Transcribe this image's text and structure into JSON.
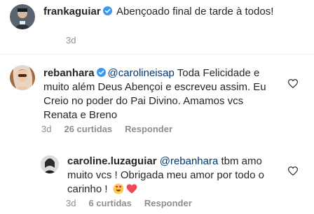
{
  "caption": {
    "username": "frankaguiar",
    "text": " Abençoado final de tarde à todos!",
    "time": "3d"
  },
  "comment": {
    "username": "rebanhara",
    "mention": "@carolineisap",
    "text": " Toda Felicidade e muito além Deus Abençoi e escreveu assim. Eu Creio no poder do Pai Divino. Amamos vcs Renata e Breno",
    "time": "3d",
    "likes": "26 curtidas",
    "reply_label": "Responder"
  },
  "reply": {
    "username": "caroline.luzaguiar",
    "mention": "@rebanhara",
    "text": " tbm amo muito vcs ! Obrigada meu amor por todo o carinho ! ",
    "time": "3d",
    "likes": "6 curtidas",
    "reply_label": "Responder"
  },
  "colors": {
    "verified": "#3897f0",
    "mention": "#00376b",
    "meta": "#8e8e8e",
    "heart_outline": "#262626",
    "heart_emoji": "#ed4956"
  },
  "icons": {
    "verified": "verified-badge-icon",
    "like": "heart-outline-icon",
    "emoji_1": "heart-eyes-emoji",
    "emoji_2": "red-heart-emoji"
  }
}
